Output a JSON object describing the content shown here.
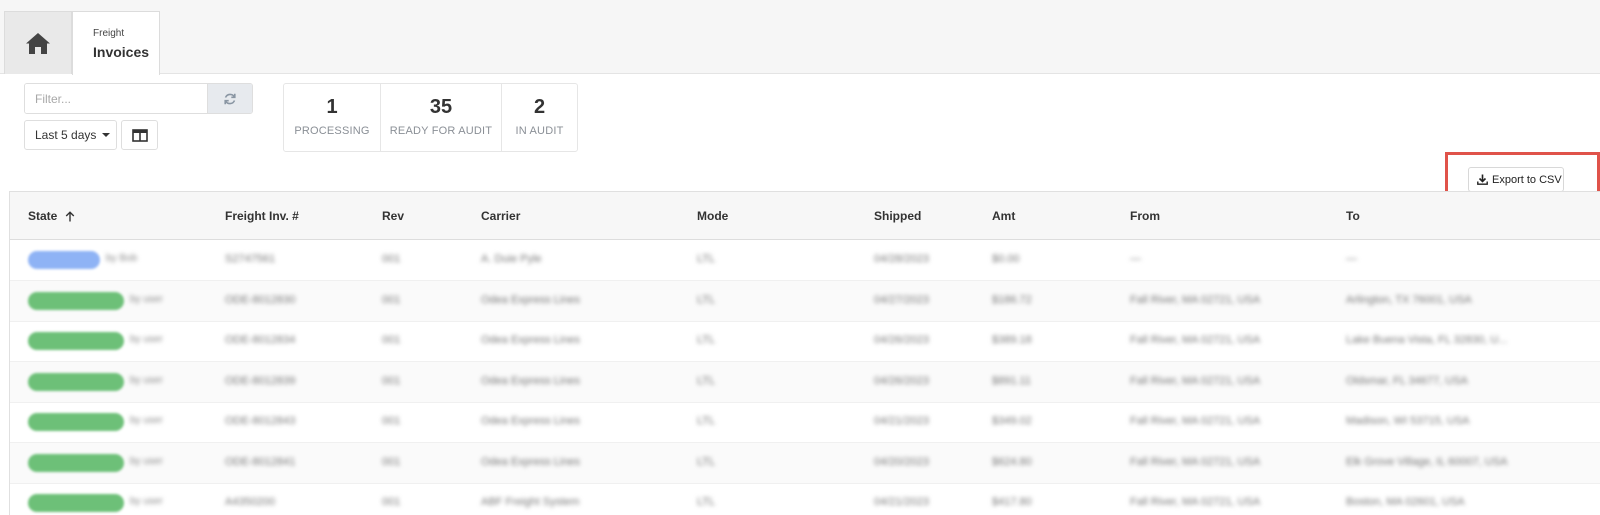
{
  "nav": {
    "home_icon": "home-icon",
    "tab_kicker": "Freight",
    "tab_title": "Invoices"
  },
  "toolbar": {
    "filter_placeholder": "Filter...",
    "refresh_icon": "refresh-icon",
    "date_range": "Last 5 days",
    "columns_icon": "columns-icon"
  },
  "stats": [
    {
      "count": "1",
      "label": "PROCESSING"
    },
    {
      "count": "35",
      "label": "READY FOR AUDIT"
    },
    {
      "count": "2",
      "label": "IN AUDIT"
    }
  ],
  "export": {
    "label": "Export to CSV",
    "icon": "download-icon",
    "highlight_color": "#e0534a"
  },
  "table": {
    "columns": [
      "State",
      "Freight Inv. #",
      "Rev",
      "Carrier",
      "Mode",
      "Shipped",
      "Amt",
      "From",
      "To"
    ],
    "sort_icon": "arrow-up-icon",
    "rows": [
      {
        "state": "Processing",
        "by": "by Bob",
        "inv": "S2747561",
        "rev": "001",
        "carrier": "A. Duie Pyle",
        "mode": "LTL",
        "shipped": "04/28/2023",
        "amt": "$0.00",
        "from": "—",
        "to": "—"
      },
      {
        "state": "Ready for Audit",
        "by": "by user",
        "inv": "ODE-8012830",
        "rev": "001",
        "carrier": "Odea Express Lines",
        "mode": "LTL",
        "shipped": "04/27/2023",
        "amt": "$186.72",
        "from": "Fall River, MA 02721, USA",
        "to": "Arlington, TX 76001, USA"
      },
      {
        "state": "Ready for Audit",
        "by": "by user",
        "inv": "ODE-8012834",
        "rev": "001",
        "carrier": "Odea Express Lines",
        "mode": "LTL",
        "shipped": "04/26/2023",
        "amt": "$389.18",
        "from": "Fall River, MA 02721, USA",
        "to": "Lake Buena Vista, FL 32830, U..."
      },
      {
        "state": "Ready for Audit",
        "by": "by user",
        "inv": "ODE-8012839",
        "rev": "001",
        "carrier": "Odea Express Lines",
        "mode": "LTL",
        "shipped": "04/26/2023",
        "amt": "$891.11",
        "from": "Fall River, MA 02721, USA",
        "to": "Oldsmar, FL 34677, USA"
      },
      {
        "state": "Ready for Audit",
        "by": "by user",
        "inv": "ODE-8012843",
        "rev": "001",
        "carrier": "Odea Express Lines",
        "mode": "LTL",
        "shipped": "04/21/2023",
        "amt": "$349.02",
        "from": "Fall River, MA 02721, USA",
        "to": "Madison, WI 53715, USA"
      },
      {
        "state": "Ready for Audit",
        "by": "by user",
        "inv": "ODE-8012841",
        "rev": "001",
        "carrier": "Odea Express Lines",
        "mode": "LTL",
        "shipped": "04/20/2023",
        "amt": "$624.80",
        "from": "Fall River, MA 02721, USA",
        "to": "Elk Grove Village, IL 60007, USA"
      },
      {
        "state": "Ready for Audit",
        "by": "by user",
        "inv": "A4350200",
        "rev": "001",
        "carrier": "ABF Freight System",
        "mode": "LTL",
        "shipped": "04/21/2023",
        "amt": "$417.80",
        "from": "Fall River, MA 02721, USA",
        "to": "Boston, MA 02601, USA"
      }
    ]
  }
}
